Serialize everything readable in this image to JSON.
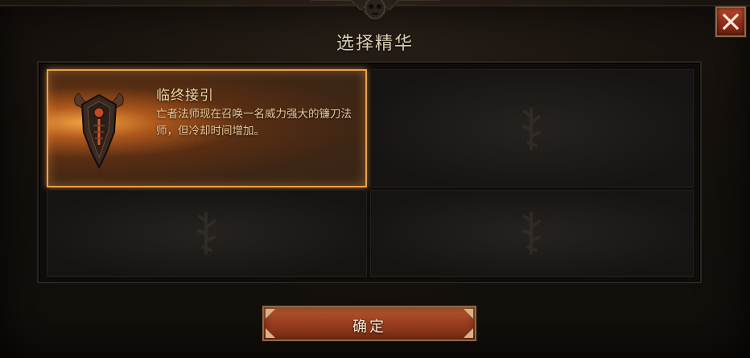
{
  "dialog": {
    "title": "选择精华"
  },
  "close_button": {
    "icon": "close-icon"
  },
  "essences": [
    {
      "name": "临终接引",
      "description": "亡者法师现在召唤一名威力强大的镰刀法师，但冷却时间增加。",
      "selected": true,
      "icon": "necromancer-shield-emblem-icon"
    },
    {
      "name": "",
      "description": "",
      "selected": false,
      "icon": "empty-slot-rune-icon"
    },
    {
      "name": "",
      "description": "",
      "selected": false,
      "icon": "empty-slot-rune-icon"
    },
    {
      "name": "",
      "description": "",
      "selected": false,
      "icon": "empty-slot-rune-icon"
    }
  ],
  "confirm_button": {
    "label": "确定"
  },
  "colors": {
    "accent_border": "#e9a24a",
    "button_red": "#9a3f1f",
    "title_text": "#d9ccb4",
    "essence_name": "#f2d9a4"
  }
}
